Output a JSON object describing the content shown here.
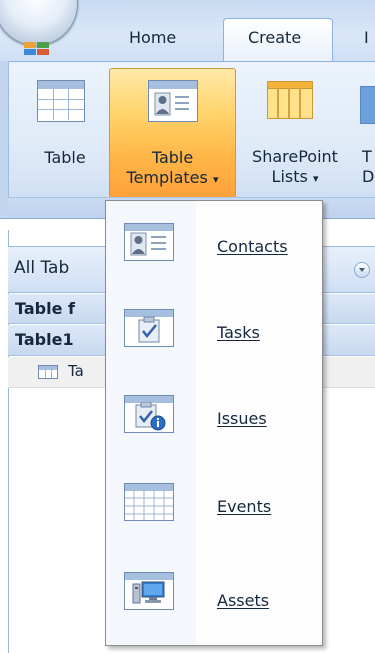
{
  "tabs": [
    {
      "label": "Home"
    },
    {
      "label": "Create",
      "active": true
    }
  ],
  "ribbon": {
    "buttons": [
      {
        "label": "Table"
      },
      {
        "label_line1": "Table",
        "label_line2": "Templates",
        "dropdown": "▾",
        "active": true
      },
      {
        "label_line1": "SharePoint",
        "label_line2": "Lists",
        "dropdown": "▾"
      }
    ],
    "clipped_fragments": {
      "line1": "T",
      "line2": "D"
    }
  },
  "nav_pane": {
    "header": "All Tab",
    "rows": [
      {
        "label": "Table f"
      },
      {
        "label": "Table1"
      }
    ],
    "item_fragment": "Ta"
  },
  "dropdown_menu": {
    "items": [
      {
        "label": "Contacts",
        "icon": "contacts-template-icon"
      },
      {
        "label": "Tasks",
        "icon": "tasks-template-icon"
      },
      {
        "label": "Issues",
        "icon": "issues-template-icon"
      },
      {
        "label": "Events",
        "icon": "events-template-icon"
      },
      {
        "label": "Assets",
        "icon": "assets-template-icon"
      }
    ]
  },
  "colors": {
    "ribbon_blue": "#dfeaf8",
    "selected_orange": "#ffb545",
    "text_dark": "#15283d",
    "border_blue": "#8db2e3"
  }
}
